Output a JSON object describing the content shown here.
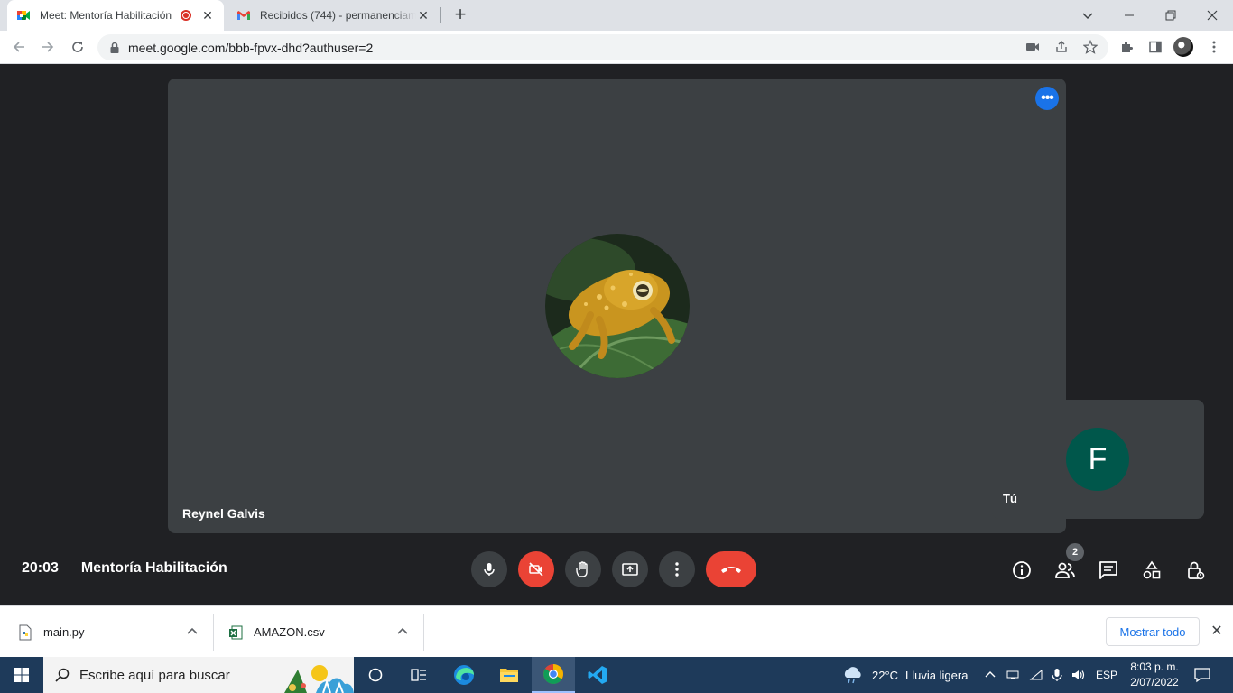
{
  "browser": {
    "tabs": [
      {
        "title": "Meet: Mentoría Habilitación",
        "recording": true,
        "active": true
      },
      {
        "title": "Recibidos (744) - permanenciamintic",
        "active": false
      }
    ],
    "new_tab_label": "+",
    "url": "meet.google.com/bbb-fpvx-dhd?authuser=2"
  },
  "meet": {
    "main_participant": {
      "name": "Reynel Galvis"
    },
    "self_participant": {
      "label": "Tú",
      "initial": "F",
      "avatar_color": "#00574b"
    },
    "time": "20:03",
    "meeting_title": "Mentoría Habilitación",
    "participants_count": "2",
    "colors": {
      "hangup": "#ea4335",
      "accent": "#1a73e8",
      "tile": "#3c4043",
      "background": "#202124"
    }
  },
  "downloads": {
    "items": [
      {
        "name": "main.py",
        "icon": "python-file-icon"
      },
      {
        "name": "AMAZON.csv",
        "icon": "excel-file-icon"
      }
    ],
    "show_all_label": "Mostrar todo"
  },
  "taskbar": {
    "search_placeholder": "Escribe aquí para buscar",
    "weather": {
      "temp": "22°C",
      "condition": "Lluvia ligera"
    },
    "language": "ESP",
    "clock": {
      "time": "8:03 p. m.",
      "date": "2/07/2022"
    }
  }
}
